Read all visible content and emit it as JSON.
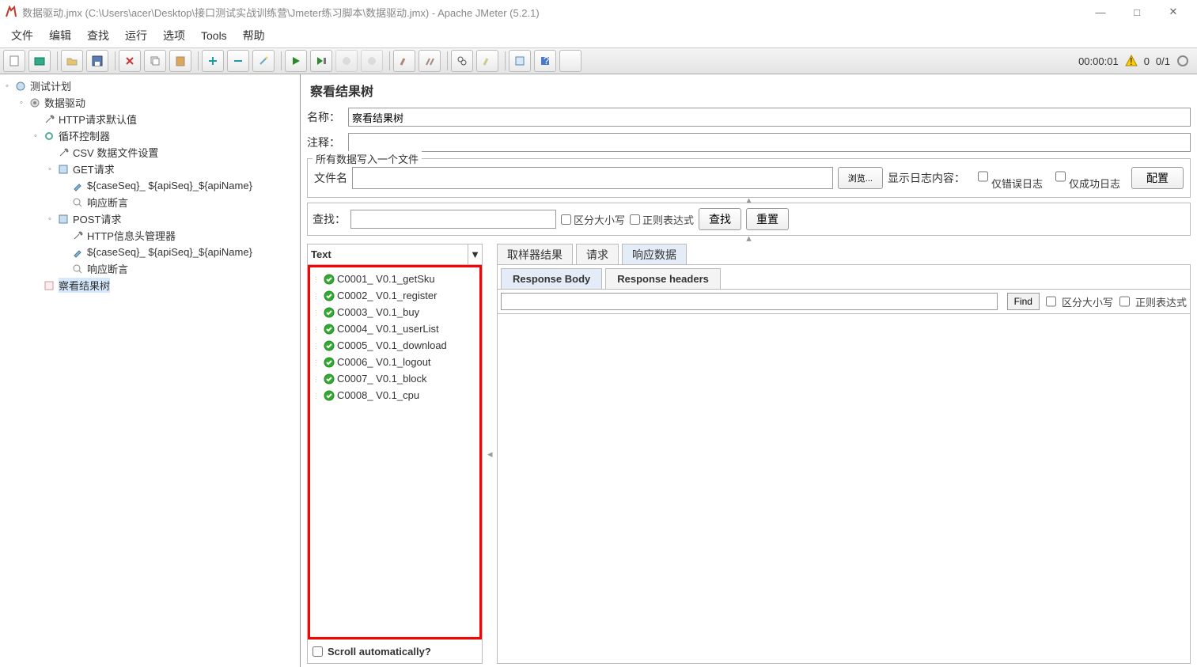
{
  "title": "数据驱动.jmx (C:\\Users\\acer\\Desktop\\接口测试实战训练营\\Jmeter练习脚本\\数据驱动.jmx) - Apache JMeter (5.2.1)",
  "menu": [
    "文件",
    "编辑",
    "查找",
    "运行",
    "选项",
    "Tools",
    "帮助"
  ],
  "status": {
    "time": "00:00:01",
    "threads": "0/1",
    "warn": "0"
  },
  "tree": {
    "root": "测试计划",
    "n1": "数据驱动",
    "n2": "HTTP请求默认值",
    "n3": "循环控制器",
    "n4": "CSV 数据文件设置",
    "n5": "GET请求",
    "n6": "${caseSeq}_ ${apiSeq}_${apiName}",
    "n7": "响应断言",
    "n8": "POST请求",
    "n9": "HTTP信息头管理器",
    "n10": "${caseSeq}_ ${apiSeq}_${apiName}",
    "n11": "响应断言",
    "n12": "察看结果树"
  },
  "panel": {
    "title": "察看结果树",
    "name_label": "名称：",
    "name_value": "察看结果树",
    "comment_label": "注释：",
    "file_section": "所有数据写入一个文件",
    "file_label": "文件名",
    "browse": "浏览...",
    "show_log": "显示日志内容：",
    "only_error": "仅错误日志",
    "only_success": "仅成功日志",
    "configure": "配置",
    "search_label": "查找：",
    "case_sensitive": "区分大小写",
    "regex": "正则表达式",
    "search_btn": "查找",
    "reset_btn": "重置",
    "renderer": "Text",
    "scroll_auto": "Scroll automatically?",
    "tabs": {
      "sampler": "取样器结果",
      "request": "请求",
      "response": "响应数据"
    },
    "subtabs": {
      "body": "Response Body",
      "headers": "Response headers"
    },
    "find_btn": "Find"
  },
  "results": [
    "C0001_ V0.1_getSku",
    "C0002_ V0.1_register",
    "C0003_ V0.1_buy",
    "C0004_ V0.1_userList",
    "C0005_ V0.1_download",
    "C0006_ V0.1_logout",
    "C0007_ V0.1_block",
    "C0008_ V0.1_cpu"
  ]
}
